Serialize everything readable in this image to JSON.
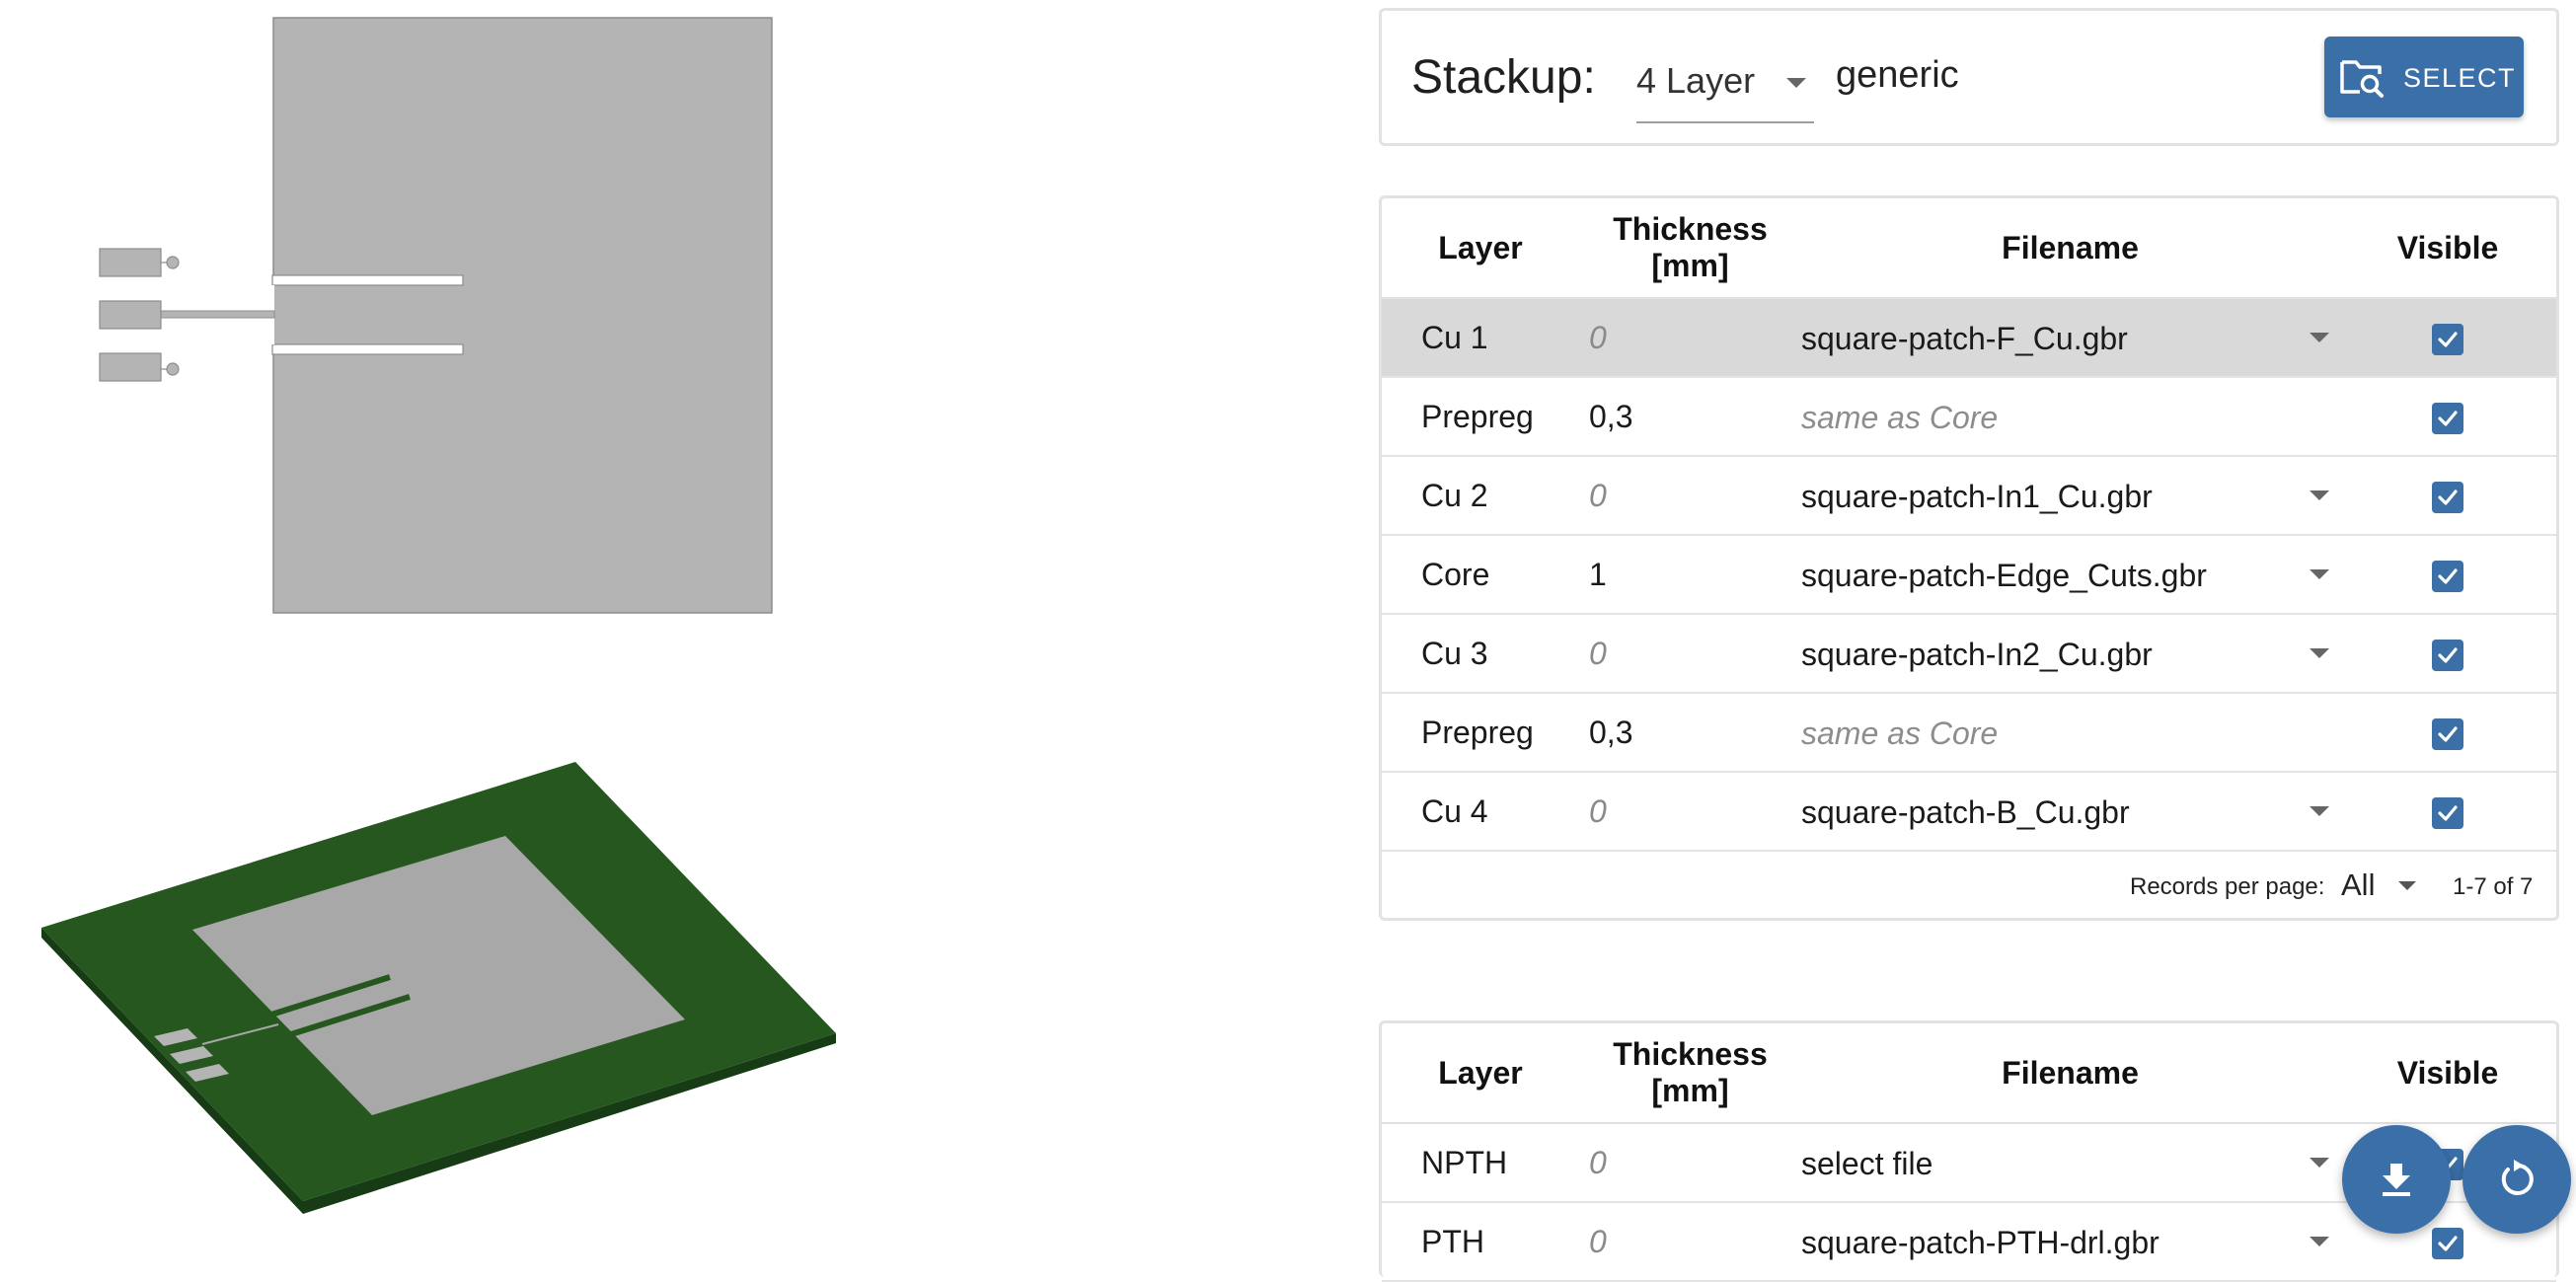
{
  "stackup": {
    "label": "Stackup:",
    "layer_count": "4 Layer",
    "name": "generic",
    "select_button": "SELECT"
  },
  "columns": {
    "layer": "Layer",
    "thickness": "Thickness [mm]",
    "filename": "Filename",
    "visible": "Visible"
  },
  "layers": [
    {
      "layer": "Cu 1",
      "thickness": "0",
      "filename": "square-patch-F_Cu.gbr",
      "visible": true
    },
    {
      "layer": "Prepreg",
      "thickness": "0,3",
      "filename": "same as Core",
      "visible": true
    },
    {
      "layer": "Cu 2",
      "thickness": "0",
      "filename": "square-patch-In1_Cu.gbr",
      "visible": true
    },
    {
      "layer": "Core",
      "thickness": "1",
      "filename": "square-patch-Edge_Cuts.gbr",
      "visible": true
    },
    {
      "layer": "Cu 3",
      "thickness": "0",
      "filename": "square-patch-In2_Cu.gbr",
      "visible": true
    },
    {
      "layer": "Prepreg",
      "thickness": "0,3",
      "filename": "same as Core",
      "visible": true
    },
    {
      "layer": "Cu 4",
      "thickness": "0",
      "filename": "square-patch-B_Cu.gbr",
      "visible": true
    }
  ],
  "pagination": {
    "records_label": "Records per page:",
    "records_value": "All",
    "range": "1-7 of 7"
  },
  "drills": [
    {
      "layer": "NPTH",
      "thickness": "0",
      "filename": "select file",
      "visible": true
    },
    {
      "layer": "PTH",
      "thickness": "0",
      "filename": "square-patch-PTH-drl.gbr",
      "visible": true
    }
  ],
  "icons": {
    "select": "folder-search-icon",
    "download": "download-icon",
    "reset": "reset-icon",
    "checkbox": "checkbox-checked-icon",
    "dropdown": "chevron-down-icon"
  },
  "colors": {
    "accent": "#3b6fa8",
    "selected_row": "#d9d9d9",
    "pcb_green": "#25571f",
    "copper_preview": "#b4b4b4"
  }
}
